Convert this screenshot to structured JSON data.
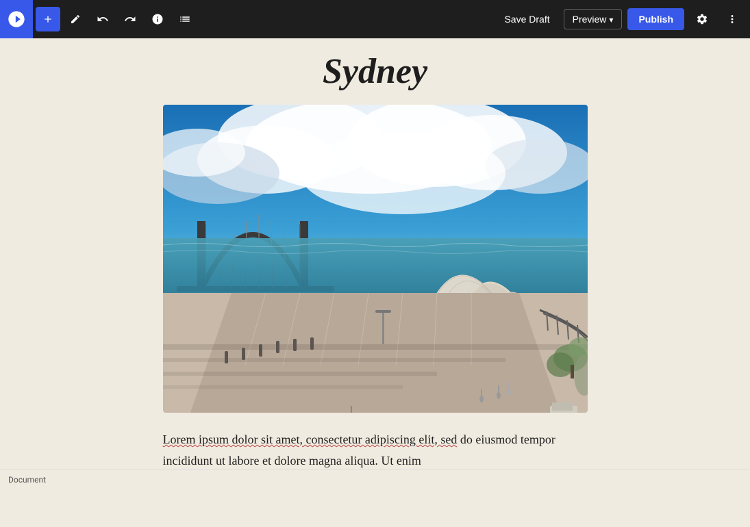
{
  "toolbar": {
    "add_label": "+",
    "save_draft_label": "Save Draft",
    "preview_label": "Preview",
    "publish_label": "Publish"
  },
  "editor": {
    "title": "Sydney",
    "body_paragraph1": "Lorem ipsum dolor sit amet, consectetur adipiscing elit, sed do eiusmod tempor incididunt ut labore et dolore magna aliqua. Ut enim"
  },
  "status_bar": {
    "label": "Document"
  }
}
